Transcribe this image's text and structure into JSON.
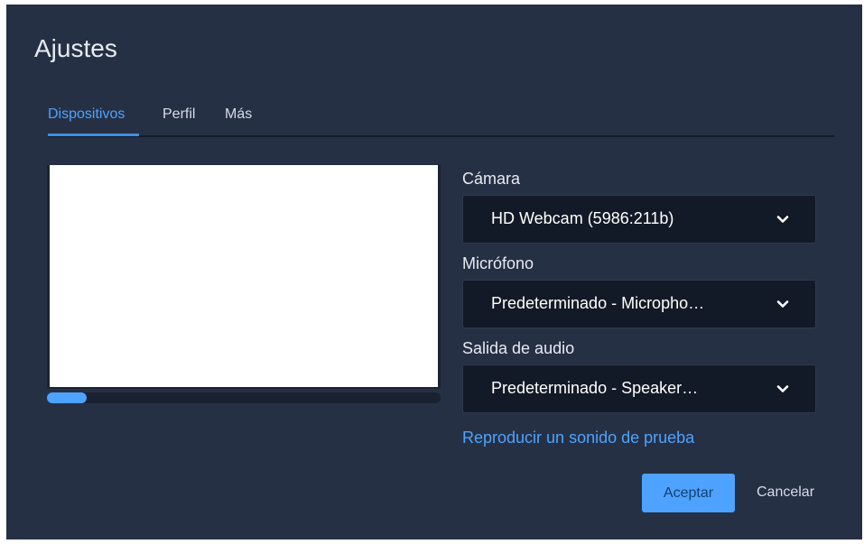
{
  "dialog": {
    "title": "Ajustes",
    "tabs": [
      {
        "label": "Dispositivos",
        "active": true
      },
      {
        "label": "Perfil",
        "active": false
      },
      {
        "label": "Más",
        "active": false
      }
    ]
  },
  "devices": {
    "camera_label": "Cámara",
    "camera_value": "HD Webcam (5986:211b)",
    "microphone_label": "Micrófono",
    "microphone_value": "Predeterminado - Micropho…",
    "audio_output_label": "Salida de audio",
    "audio_output_value": "Predeterminado - Speaker…",
    "test_sound_link": "Reproducir un sonido de prueba",
    "mic_level_fraction": 0.1
  },
  "actions": {
    "accept_label": "Aceptar",
    "cancel_label": "Cancelar"
  },
  "colors": {
    "background": "#263044",
    "accent": "#4da3ff",
    "select_background": "#131a27"
  },
  "icons": {
    "dropdown": "chevron-down-icon"
  }
}
